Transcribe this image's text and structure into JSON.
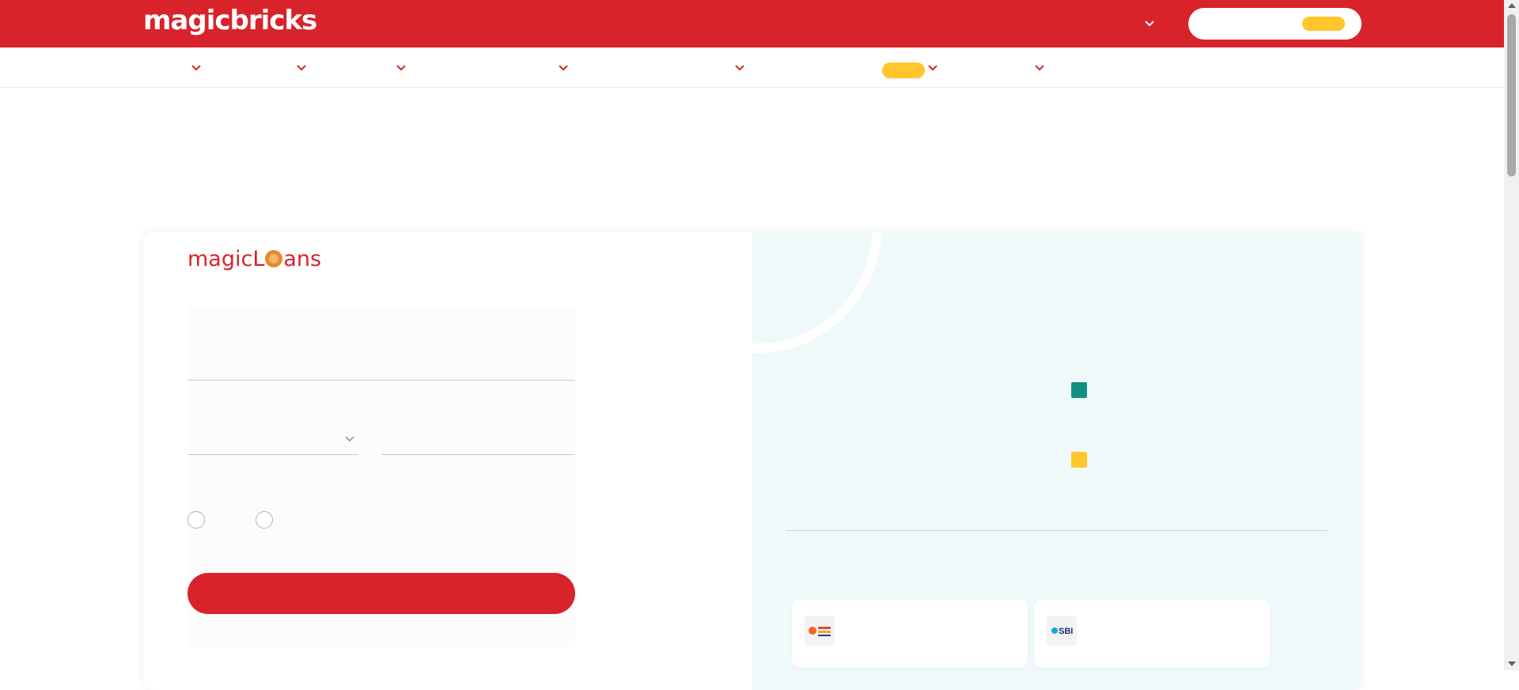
{
  "header": {
    "logo_text": "magicbricks",
    "brand_color": "#d8232a",
    "accent_color": "#ffc72c",
    "city_dropdown_icon": "chevron-down-icon"
  },
  "nav": {
    "dropdown_icon": "chevron-down-icon"
  },
  "loan_form": {
    "logo_text_before": "magicL",
    "logo_text_after": "ans"
  },
  "chart_panel": {
    "legend_colors": [
      "#0e9180",
      "#ffc72c"
    ]
  },
  "banks": [
    {
      "logo_text": "",
      "icon": "bank-of-baroda-logo"
    },
    {
      "logo_text": "SBI",
      "icon": "sbi-logo"
    }
  ]
}
